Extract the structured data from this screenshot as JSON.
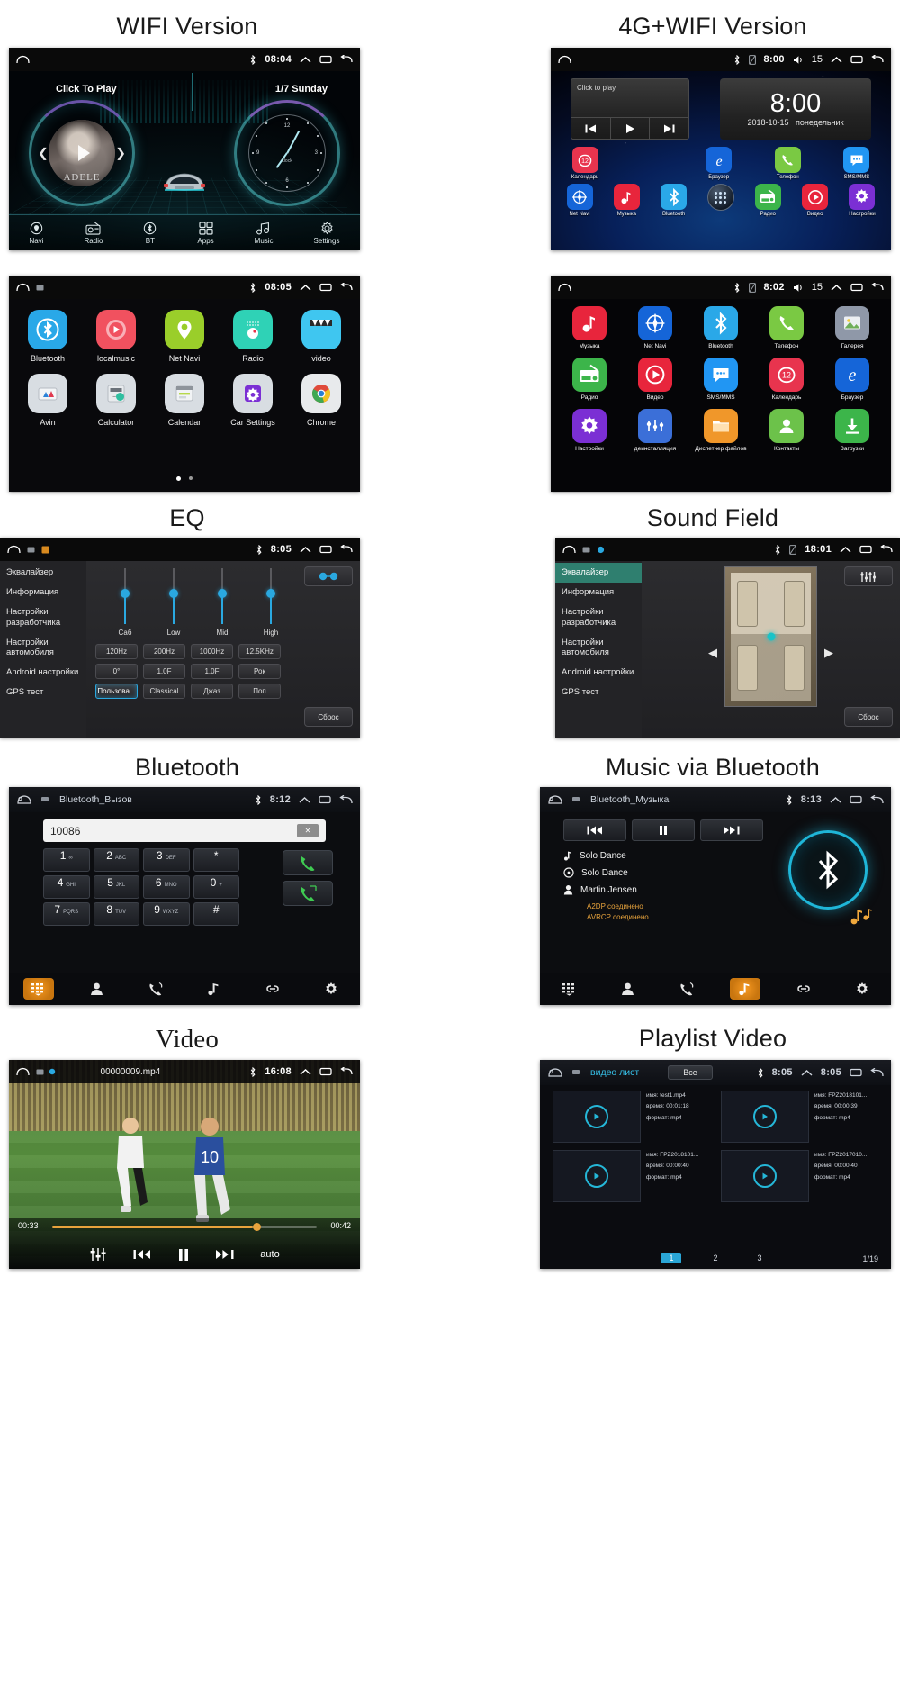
{
  "sections": {
    "wifi_version": "WIFI Version",
    "fourg_version": "4G+WIFI Version",
    "eq": "EQ",
    "sound_field": "Sound Field",
    "bluetooth": "Bluetooth",
    "music_via_bt": "Music via Bluetooth",
    "video": "Video",
    "playlist_video": "Playlist Video"
  },
  "panel_home_wifi": {
    "status": {
      "time": "08:04"
    },
    "left_dial_label": "Click To Play",
    "right_dial_label": "1/7  Sunday",
    "album_text": "ADELE",
    "clock_label": "clock",
    "clock_numbers": [
      "12",
      "3",
      "6",
      "9"
    ],
    "dock": [
      {
        "label": "Navi",
        "icon": "location-pin-icon"
      },
      {
        "label": "Radio",
        "icon": "radio-icon"
      },
      {
        "label": "BT",
        "icon": "bluetooth-icon"
      },
      {
        "label": "Apps",
        "icon": "apps-grid-icon"
      },
      {
        "label": "Music",
        "icon": "music-note-icon"
      },
      {
        "label": "Settings",
        "icon": "gear-icon"
      }
    ]
  },
  "panel_home_4g": {
    "status": {
      "time": "8:00",
      "volume": "15"
    },
    "player_widget": {
      "label": "Click to play"
    },
    "clock_widget": {
      "time": "8:00",
      "date": "2018-10-15",
      "weekday": "понедельник"
    },
    "apps_row1": [
      {
        "label": "Календарь",
        "icon": "calendar-icon",
        "color": "#e8344e"
      },
      {
        "label": "Браузер",
        "icon": "ie-browser-icon",
        "color": "#1565d8"
      },
      {
        "label": "Телефон",
        "icon": "phone-icon",
        "color": "#7ac943"
      },
      {
        "label": "SMS/MMS",
        "icon": "message-icon",
        "color": "#2196f3"
      }
    ],
    "apps_row2": [
      {
        "label": "Net Navi",
        "icon": "compass-icon",
        "color": "#1565d8"
      },
      {
        "label": "Музыка",
        "icon": "music-note-icon",
        "color": "#e8253c"
      },
      {
        "label": "Bluetooth",
        "icon": "bluetooth-icon",
        "color": "#2aa8e8"
      },
      {
        "label": "",
        "icon": "app-drawer-icon",
        "color": "#1d2b3c"
      },
      {
        "label": "Радио",
        "icon": "radio-icon",
        "color": "#3cb54a"
      },
      {
        "label": "Видео",
        "icon": "play-circle-icon",
        "color": "#e8253c"
      },
      {
        "label": "Настройки",
        "icon": "gear-icon",
        "color": "#7b2fd4"
      }
    ]
  },
  "panel_drawer_en": {
    "status": {
      "time": "08:05"
    },
    "row1": [
      {
        "label": "Bluetooth",
        "icon": "bluetooth-icon",
        "color": "#29a8e8"
      },
      {
        "label": "localmusic",
        "icon": "play-circle-icon",
        "color": "#f1515f"
      },
      {
        "label": "Net Navi",
        "icon": "location-pin-icon",
        "color": "#9ace2a"
      },
      {
        "label": "Radio",
        "icon": "radio-icon",
        "color": "#2fd2b6"
      },
      {
        "label": "video",
        "icon": "clapperboard-icon",
        "color": "#3fc6f0"
      }
    ],
    "row2": [
      {
        "label": "Avin",
        "icon": "avin-icon",
        "color": "#d8dde2"
      },
      {
        "label": "Calculator",
        "icon": "calculator-icon",
        "color": "#d8dde2"
      },
      {
        "label": "Calendar",
        "icon": "calendar-icon",
        "color": "#d8dde2"
      },
      {
        "label": "Car Settings",
        "icon": "car-settings-icon",
        "color": "#d8dde2"
      },
      {
        "label": "Chrome",
        "icon": "chrome-icon",
        "color": "#e8eaec"
      }
    ],
    "page_indicator": {
      "current": 1,
      "total": 2
    }
  },
  "panel_drawer_ru": {
    "status": {
      "time": "8:02",
      "volume": "15"
    },
    "row1": [
      {
        "label": "Музыка",
        "icon": "music-note-icon",
        "color": "#e8253c"
      },
      {
        "label": "Net Navi",
        "icon": "compass-icon",
        "color": "#1565d8"
      },
      {
        "label": "Bluetooth",
        "icon": "bluetooth-icon",
        "color": "#2aa8e8"
      },
      {
        "label": "Телефон",
        "icon": "phone-icon",
        "color": "#7ac943"
      },
      {
        "label": "Галерея",
        "icon": "gallery-icon",
        "color": "#8f98a8"
      }
    ],
    "row2": [
      {
        "label": "Радио",
        "icon": "radio-icon",
        "color": "#3cb54a"
      },
      {
        "label": "Видео",
        "icon": "play-circle-icon",
        "color": "#e8253c"
      },
      {
        "label": "SMS/MMS",
        "icon": "message-icon",
        "color": "#2196f3"
      },
      {
        "label": "Календарь",
        "icon": "calendar-icon",
        "color": "#e8344e"
      },
      {
        "label": "Браузер",
        "icon": "ie-browser-icon",
        "color": "#1565d8"
      }
    ],
    "row3": [
      {
        "label": "Настройки",
        "icon": "gear-icon",
        "color": "#7b2fd4"
      },
      {
        "label": "деинсталляция",
        "icon": "uninstall-icon",
        "color": "#3b6fd8"
      },
      {
        "label": "Диспетчер файлов",
        "icon": "folder-icon",
        "color": "#f0972a"
      },
      {
        "label": "Контакты",
        "icon": "contacts-icon",
        "color": "#6cc24a"
      },
      {
        "label": "Загрузки",
        "icon": "download-icon",
        "color": "#3cb54a"
      }
    ]
  },
  "panel_eq": {
    "status": {
      "time": "8:05"
    },
    "menu": [
      "Эквалайзер",
      "Информация",
      "Настройки разработчика",
      "Настройки автомобиля",
      "Android настройки",
      "GPS тест"
    ],
    "active_menu": "Эквалайзер",
    "sliders": [
      {
        "label": "Саб"
      },
      {
        "label": "Low"
      },
      {
        "label": "Mid"
      },
      {
        "label": "High"
      }
    ],
    "freq_row": [
      "120Hz",
      "200Hz",
      "1000Hz",
      "12.5KHz"
    ],
    "gain_row": [
      "0°",
      "1.0F",
      "1.0F",
      "Рок"
    ],
    "preset_row": [
      "Пользова...",
      "Classical",
      "Джаз",
      "Поп"
    ],
    "selected_preset": "Пользова...",
    "reset_label": "Сброс",
    "balance_button": "balance-icon"
  },
  "panel_sound_field": {
    "status": {
      "time": "18:01"
    },
    "menu": [
      "Эквалайзер",
      "Информация",
      "Настройки разработчика",
      "Настройки автомобиля",
      "Android настройки",
      "GPS тест"
    ],
    "active_menu": "Эквалайзер",
    "reset_label": "Сброс",
    "eq_button": "equalizer-bars-icon"
  },
  "panel_bluetooth": {
    "status": {
      "time": "8:12"
    },
    "title": "Bluetooth_Вызов",
    "dialed_number": "10086",
    "keys": [
      {
        "digit": "1",
        "sub": "∞"
      },
      {
        "digit": "2",
        "sub": "ABC"
      },
      {
        "digit": "3",
        "sub": "DEF"
      },
      {
        "digit": "*",
        "sub": ""
      },
      {
        "digit": "4",
        "sub": "GHI"
      },
      {
        "digit": "5",
        "sub": "JKL"
      },
      {
        "digit": "6",
        "sub": "MNO"
      },
      {
        "digit": "0",
        "sub": "+"
      },
      {
        "digit": "7",
        "sub": "PQRS"
      },
      {
        "digit": "8",
        "sub": "TUV"
      },
      {
        "digit": "9",
        "sub": "WXYZ"
      },
      {
        "digit": "#",
        "sub": ""
      }
    ],
    "tabs": [
      "keypad-icon",
      "contacts-icon",
      "call-log-icon",
      "music-note-icon",
      "link-icon",
      "gear-icon"
    ],
    "active_tab": "keypad-icon"
  },
  "panel_bt_music": {
    "status": {
      "time": "8:13"
    },
    "title": "Bluetooth_Музыка",
    "controls": [
      "prev-track-icon",
      "pause-icon",
      "next-track-icon"
    ],
    "track_title": "Solo Dance",
    "album_name": "Solo Dance",
    "artist": "Martin Jensen",
    "status_lines": [
      "A2DP соединено",
      "AVRCP соединено"
    ],
    "tabs": [
      "keypad-icon",
      "contacts-icon",
      "call-log-icon",
      "music-note-icon",
      "link-icon",
      "gear-icon"
    ],
    "active_tab": "music-note-icon"
  },
  "panel_video": {
    "status": {
      "time": "16:08"
    },
    "filename": "00000009.mp4",
    "elapsed": "00:33",
    "duration": "00:42",
    "mode_label": "auto",
    "controls": [
      "equalizer-icon",
      "prev-track-icon",
      "pause-icon",
      "next-track-icon"
    ]
  },
  "panel_playlist": {
    "status": {
      "time": "8:05",
      "extra": "8:05"
    },
    "title": "видео лист",
    "all_button": "Все",
    "items": [
      {
        "name_label": "имя:",
        "name": "test1.mp4",
        "time_label": "время:",
        "time": "00:01:18",
        "format_label": "формат:",
        "format": "mp4"
      },
      {
        "name_label": "имя:",
        "name": "FPZ2018101...",
        "time_label": "время:",
        "time": "00:00:39",
        "format_label": "формат:",
        "format": "mp4"
      },
      {
        "name_label": "имя:",
        "name": "FPZ2018101...",
        "time_label": "время:",
        "time": "00:00:40",
        "format_label": "формат:",
        "format": "mp4"
      },
      {
        "name_label": "имя:",
        "name": "FPZ2017010...",
        "time_label": "время:",
        "time": "00:00:40",
        "format_label": "формат:",
        "format": "mp4"
      }
    ],
    "pages": [
      "1",
      "2",
      "3"
    ],
    "current_page": "1",
    "page_count": "1/19"
  }
}
